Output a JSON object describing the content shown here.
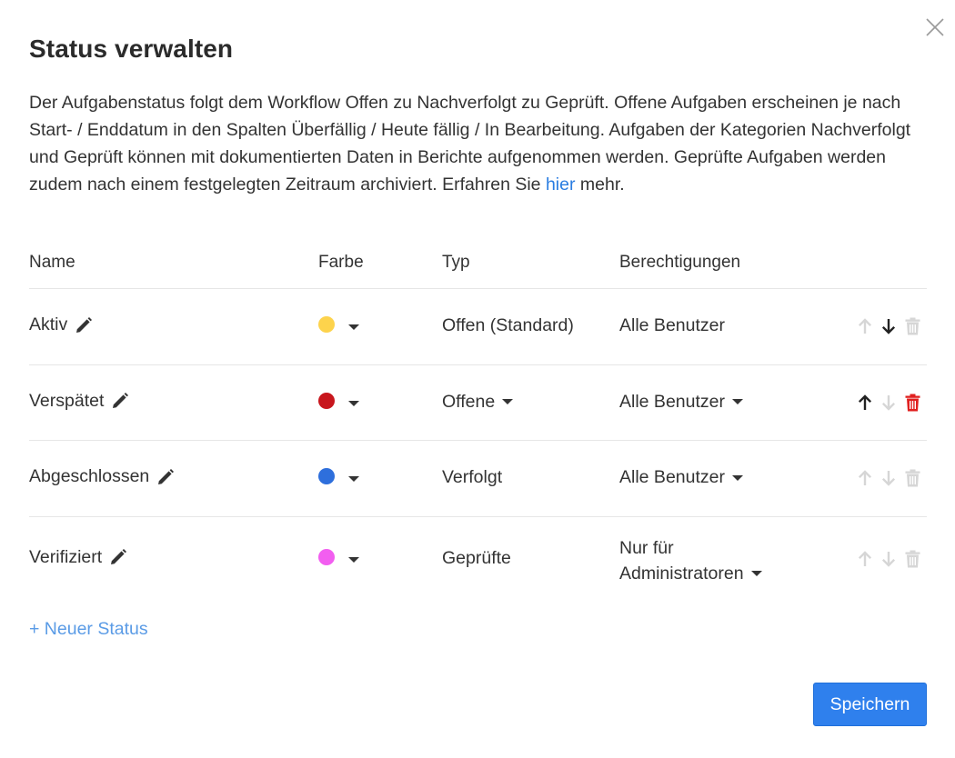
{
  "dialog": {
    "title": "Status verwalten",
    "description_text": "Der Aufgabenstatus folgt dem Workflow Offen zu Nachverfolgt zu Geprüft. Offene Aufgaben erscheinen je nach Start- / Enddatum in den Spalten Überfällig / Heute fällig / In Bearbeitung. Aufgaben der Kategorien Nachverfolgt und Geprüft können mit dokumentierten Daten in Berichte aufgenommen werden. Geprüfte Aufgaben werden zudem nach einem festgelegten Zeitraum archiviert. Erfahren Sie",
    "description_link": "hier",
    "description_after": "mehr.",
    "close_icon": "close-icon"
  },
  "table": {
    "headers": {
      "name": "Name",
      "color": "Farbe",
      "type": "Typ",
      "permissions": "Berechtigungen"
    },
    "rows": [
      {
        "name": "Aktiv",
        "color": "#fdd34c",
        "type": "Offen (Standard)",
        "type_dropdown": false,
        "permission": "Alle Benutzer",
        "permission_dropdown": false,
        "up_enabled": false,
        "down_enabled": true,
        "delete_enabled": false
      },
      {
        "name": "Verspätet",
        "color": "#c8161d",
        "type": "Offene",
        "type_dropdown": true,
        "permission": "Alle Benutzer",
        "permission_dropdown": true,
        "up_enabled": true,
        "down_enabled": false,
        "delete_enabled": true
      },
      {
        "name": "Abgeschlossen",
        "color": "#2e6fdc",
        "type": "Verfolgt",
        "type_dropdown": false,
        "permission": "Alle Benutzer",
        "permission_dropdown": true,
        "up_enabled": false,
        "down_enabled": false,
        "delete_enabled": false
      },
      {
        "name": "Verifiziert",
        "color": "#f25ef0",
        "type": "Geprüfte",
        "type_dropdown": false,
        "permission_line1": "Nur für",
        "permission_line2": "Administratoren",
        "permission_dropdown": true,
        "up_enabled": false,
        "down_enabled": false,
        "delete_enabled": false
      }
    ]
  },
  "new_status_label": "+ Neuer Status",
  "save_label": "Speichern",
  "colors": {
    "accent": "#2f80ed",
    "link": "#2a7de1",
    "delete_active": "#e0201f",
    "icon_disabled": "#d6d6d6",
    "icon_active": "#222222"
  }
}
